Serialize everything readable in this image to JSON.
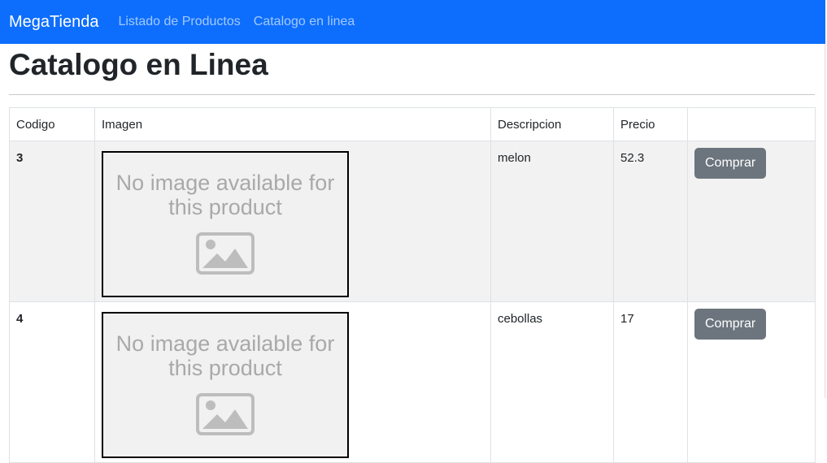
{
  "navbar": {
    "brand": "MegaTienda",
    "links": [
      "Listado de Productos",
      "Catalogo en linea"
    ]
  },
  "page": {
    "title": "Catalogo en Linea"
  },
  "table": {
    "headers": [
      "Codigo",
      "Imagen",
      "Descripcion",
      "Precio",
      ""
    ],
    "rows": [
      {
        "codigo": "3",
        "descripcion": "melon",
        "precio": "52.3",
        "image_text": "No image available for this product",
        "button": "Comprar"
      },
      {
        "codigo": "4",
        "descripcion": "cebollas",
        "precio": "17",
        "image_text": "No image available for this product",
        "button": "Comprar"
      }
    ]
  },
  "colors": {
    "navbar": "#0d6efd",
    "button": "#6c757d",
    "stripe": "#f2f2f2"
  },
  "icons": {
    "placeholder": "image-placeholder-icon"
  }
}
